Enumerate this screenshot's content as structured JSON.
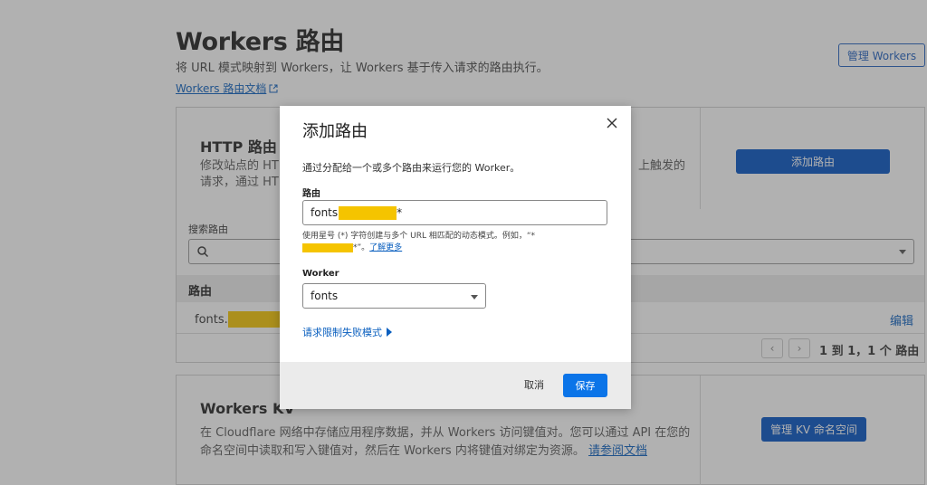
{
  "page": {
    "title": "Workers 路由",
    "subtitle": "将 URL 模式映射到 Workers，让 Workers 基于传入请求的路由执行。",
    "docs_link": "Workers 路由文档",
    "manage_workers": "管理 Workers"
  },
  "http_card": {
    "title": "HTTP 路由",
    "desc_line1": "修改站点的 HT",
    "desc_line2": "请求，通过 HT",
    "desc_right": "上触发的",
    "add_route": "添加路由",
    "search_label": "搜索路由",
    "column_route": "路由",
    "row_route_prefix": "fonts.",
    "edit": "编辑",
    "pager_info": "1 到 1，1 个 路由"
  },
  "kv_card": {
    "title": "Workers KV",
    "desc": "在 Cloudflare 网络中存储应用程序数据，并从 Workers 访问键值对。您可以通过 API 在您的命名空间中读取和写入键值对，然后在 Workers 内将键值对绑定为资源。",
    "doc_link": "请参阅文档",
    "button": "管理 KV 命名空间"
  },
  "modal": {
    "title": "添加路由",
    "intro": "通过分配给一个或多个路由来运行您的 Worker。",
    "route_label": "路由",
    "route_value_prefix": "fonts",
    "route_value_suffix": "*",
    "hint_text": "使用星号 (*) 字符创建与多个 URL 相匹配的动态模式。例如，“*",
    "hint_text_end": "*”。",
    "learn_more": "了解更多",
    "worker_label": "Worker",
    "worker_value": "fonts",
    "rate_limit": "请求限制失败模式",
    "cancel": "取消",
    "save": "保存"
  },
  "colors": {
    "primary": "#0051c3",
    "save": "#0b74e8",
    "link": "#0a5fbf",
    "redaction": "#f5c400"
  },
  "icons": [
    "external-link-icon",
    "search-icon",
    "close-icon",
    "chevron-down-icon",
    "caret-right-icon"
  ]
}
